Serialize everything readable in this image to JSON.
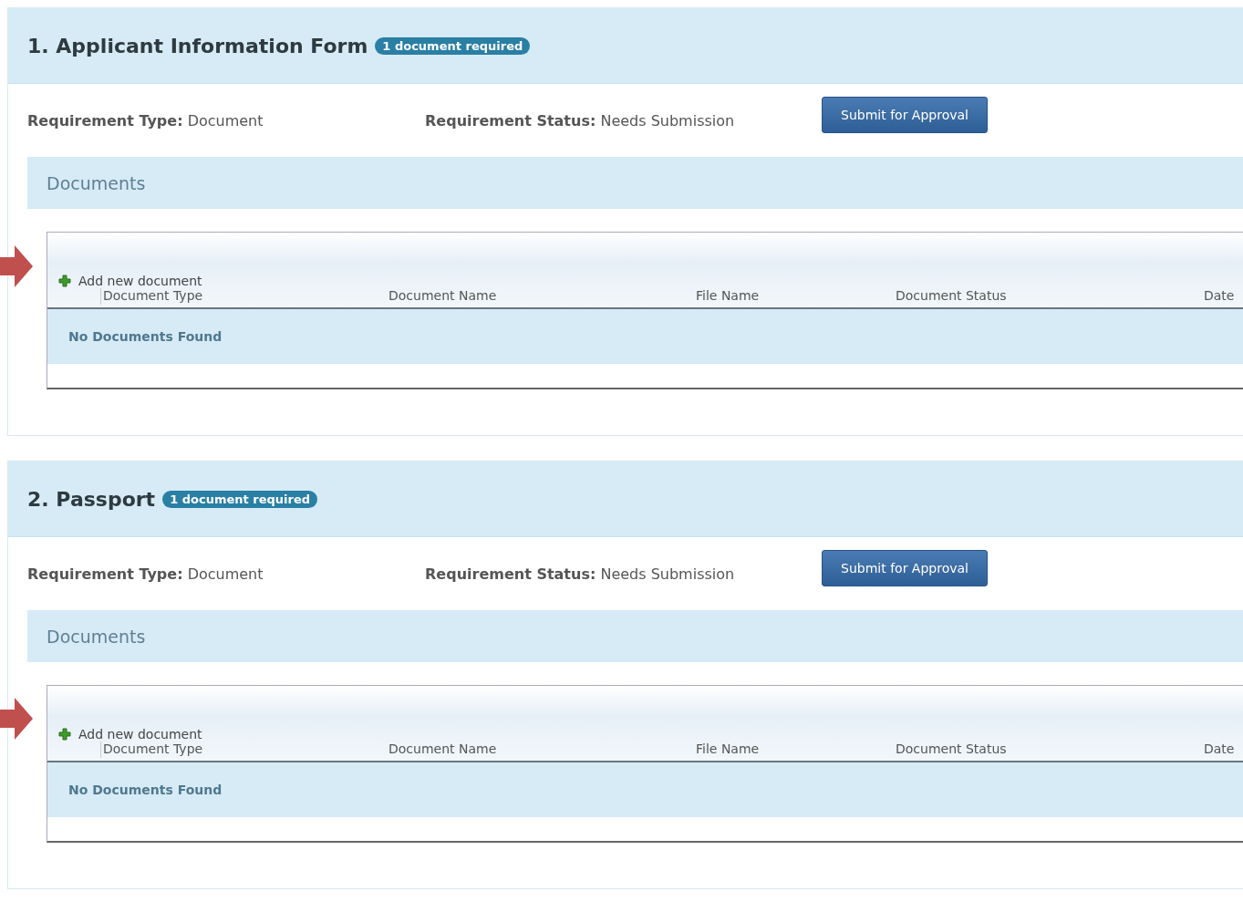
{
  "requirements": [
    {
      "number": "1.",
      "title": "Applicant Information Form",
      "badge": "1 document required",
      "type_label": "Requirement Type:",
      "type_value": "Document",
      "status_label": "Requirement Status:",
      "status_value": "Needs Submission",
      "button": "Submit for Approval",
      "section_title": "Documents",
      "add_label": "Add new document",
      "columns": [
        "Document Type",
        "Document Name",
        "File Name",
        "Document Status",
        "Date"
      ],
      "empty_text": "No Documents Found"
    },
    {
      "number": "2.",
      "title": "Passport",
      "badge": "1 document required",
      "type_label": "Requirement Type:",
      "type_value": "Document",
      "status_label": "Requirement Status:",
      "status_value": "Needs Submission",
      "button": "Submit for Approval",
      "section_title": "Documents",
      "add_label": "Add new document",
      "columns": [
        "Document Type",
        "Document Name",
        "File Name",
        "Document Status",
        "Date"
      ],
      "empty_text": "No Documents Found"
    }
  ]
}
